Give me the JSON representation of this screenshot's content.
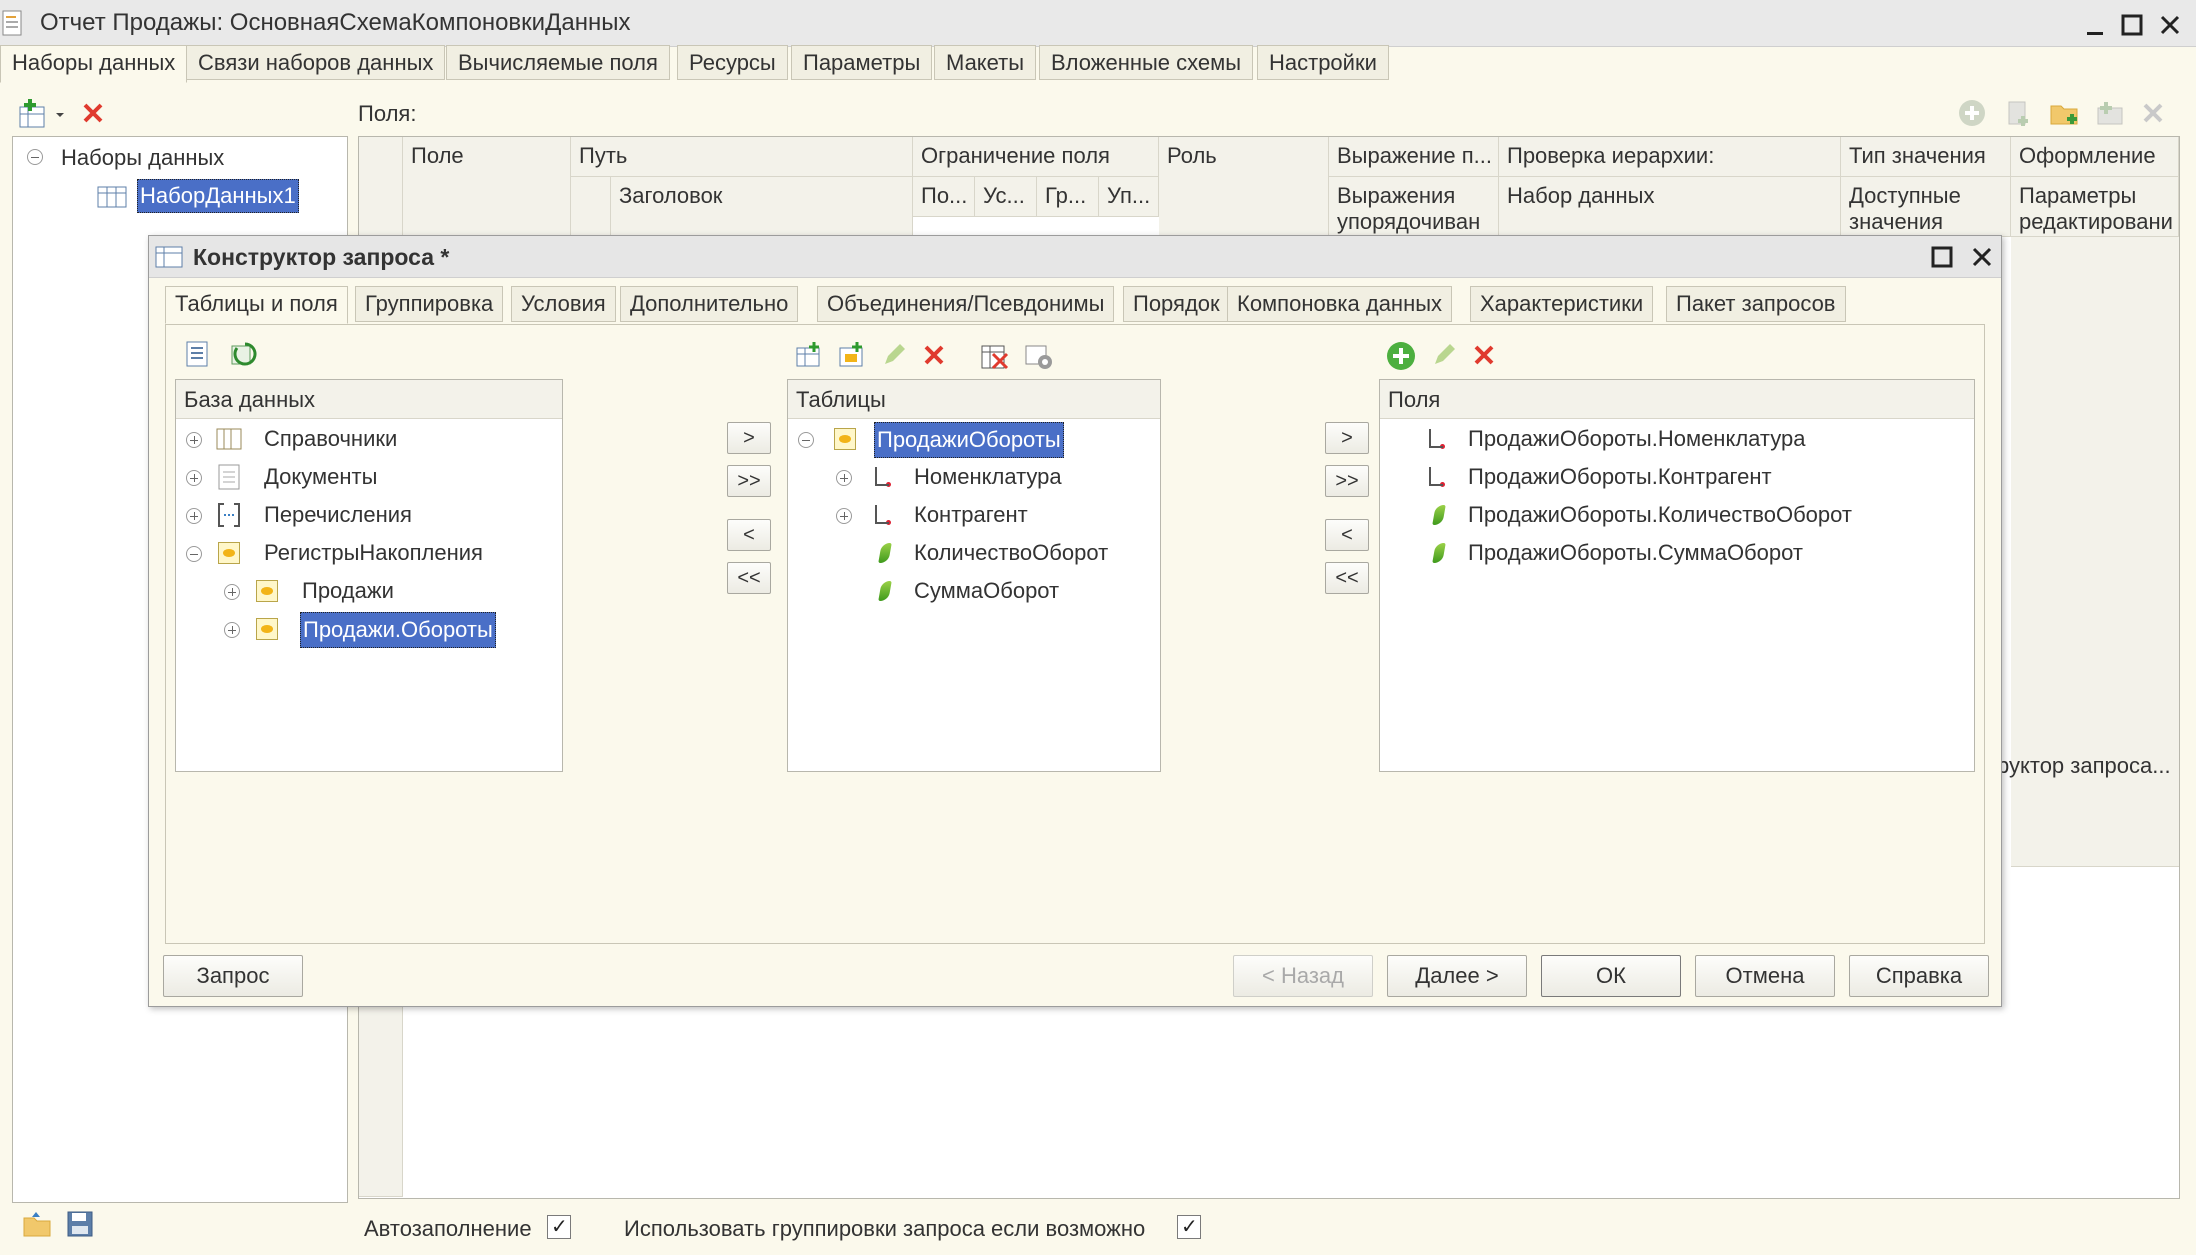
{
  "window": {
    "title": "Отчет Продажы: ОсновнаяСхемаКомпоновкиДанных"
  },
  "main_tabs": [
    {
      "label": "Наборы данных",
      "active": true
    },
    {
      "label": "Связи наборов данных"
    },
    {
      "label": "Вычисляемые поля"
    },
    {
      "label": "Ресурсы"
    },
    {
      "label": "Параметры"
    },
    {
      "label": "Макеты"
    },
    {
      "label": "Вложенные схемы"
    },
    {
      "label": "Настройки"
    }
  ],
  "left_panel": {
    "root": "Наборы данных",
    "item": "НаборДанных1"
  },
  "fields_panel": {
    "label": "Поля:",
    "columns": {
      "field": "Поле",
      "path": "Путь",
      "title": "Заголовок",
      "restriction": "Ограничение поля",
      "r1": "По...",
      "r2": "Ус...",
      "r3": "Гр...",
      "r4": "Уп...",
      "role": "Роль",
      "expr": "Выражение п...",
      "expr2": "Выражения упорядочиван",
      "hier": "Проверка иерархии:",
      "hier2": "Набор данных",
      "type": "Тип значения",
      "type2": "Доступные значения",
      "format": "Оформление",
      "format2": "Параметры редактировани"
    },
    "partial_label": "руктор запроса..."
  },
  "dialog": {
    "title": "Конструктор запроса *",
    "tabs": [
      {
        "label": "Таблицы и поля",
        "active": true
      },
      {
        "label": "Группировка"
      },
      {
        "label": "Условия"
      },
      {
        "label": "Дополнительно"
      },
      {
        "label": "Объединения/Псевдонимы"
      },
      {
        "label": "Порядок"
      },
      {
        "label": "Компоновка данных"
      },
      {
        "label": "Характеристики"
      },
      {
        "label": "Пакет запросов"
      }
    ],
    "db": {
      "header": "База данных",
      "items": [
        "Справочники",
        "Документы",
        "Перечисления",
        "РегистрыНакопления",
        "Продажи",
        "Продажи.Обороты"
      ]
    },
    "tables": {
      "header": "Таблицы",
      "root": "ПродажиОбороты",
      "items": [
        "Номенклатура",
        "Контрагент",
        "КоличествоОборот",
        "СуммаОборот"
      ]
    },
    "fields": {
      "header": "Поля",
      "items": [
        "ПродажиОбороты.Номенклатура",
        "ПродажиОбороты.Контрагент",
        "ПродажиОбороты.КоличествоОборот",
        "ПродажиОбороты.СуммаОборот"
      ]
    },
    "move": {
      "one": ">",
      "all": ">>",
      "back": "<",
      "back_all": "<<"
    },
    "buttons": {
      "query": "Запрос",
      "back": "< Назад",
      "next": "Далее >",
      "ok": "ОК",
      "cancel": "Отмена",
      "help": "Справка"
    }
  },
  "bottom": {
    "autofill": "Автозаполнение",
    "use_grouping": "Использовать группировки запроса если возможно"
  }
}
